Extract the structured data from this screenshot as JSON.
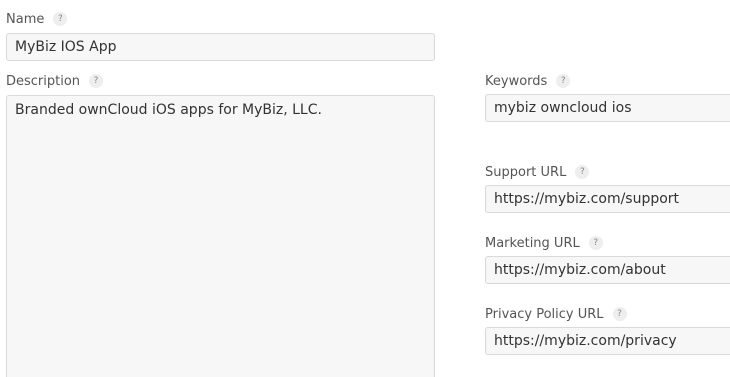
{
  "form": {
    "name": {
      "label": "Name",
      "help": "?",
      "value": "MyBiz IOS App"
    },
    "description": {
      "label": "Description",
      "help": "?",
      "value": "Branded ownCloud iOS apps for MyBiz, LLC."
    },
    "keywords": {
      "label": "Keywords",
      "help": "?",
      "value": "mybiz owncloud ios"
    },
    "support_url": {
      "label": "Support URL",
      "help": "?",
      "value": "https://mybiz.com/support"
    },
    "marketing_url": {
      "label": "Marketing URL",
      "help": "?",
      "value": "https://mybiz.com/about"
    },
    "privacy_url": {
      "label": "Privacy Policy URL",
      "help": "?",
      "value": "https://mybiz.com/privacy"
    }
  }
}
